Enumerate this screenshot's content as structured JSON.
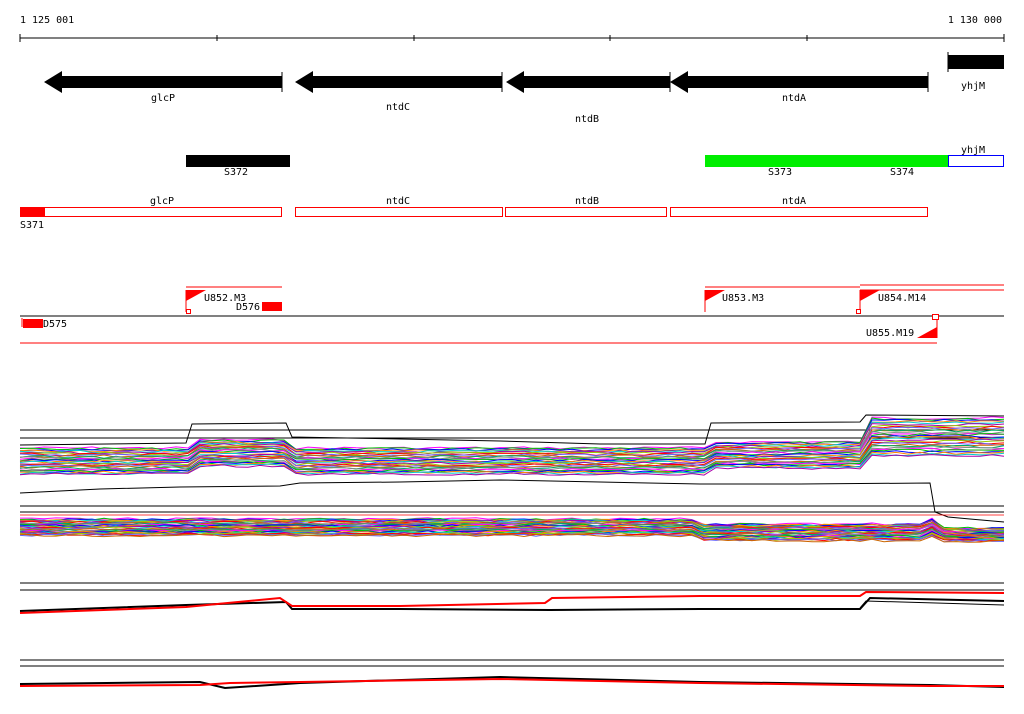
{
  "coordinates": {
    "start_label": "1 125 001",
    "end_label": "1 130 000"
  },
  "genes": [
    {
      "label": "glcP",
      "strand": "-"
    },
    {
      "label": "ntdC",
      "strand": "-"
    },
    {
      "label": "ntdB",
      "strand": "-"
    },
    {
      "label": "ntdA",
      "strand": "-"
    },
    {
      "label": "yhjM",
      "strand": "+"
    }
  ],
  "segments": [
    {
      "label": "S372",
      "color": "#000000"
    },
    {
      "label": "S373",
      "color": "#00ee00"
    },
    {
      "label": "S374",
      "color": "#00ee00"
    },
    {
      "label": "yhjM",
      "color": "#0000ff"
    }
  ],
  "cds_outlines": [
    {
      "label": "glcP"
    },
    {
      "label": "ntdC"
    },
    {
      "label": "ntdB"
    },
    {
      "label": "ntdA"
    }
  ],
  "small_segment_label": "S371",
  "transcription_units": [
    {
      "label": "U852.M3"
    },
    {
      "label": "D576"
    },
    {
      "label": "U853.M3"
    },
    {
      "label": "U854.M14"
    },
    {
      "label": "D575"
    },
    {
      "label": "U855.M19"
    }
  ],
  "colors": {
    "accent_red": "#ff0000",
    "gene_black": "#000000",
    "segment_green": "#00ee00",
    "segment_blue": "#0000ff"
  }
}
